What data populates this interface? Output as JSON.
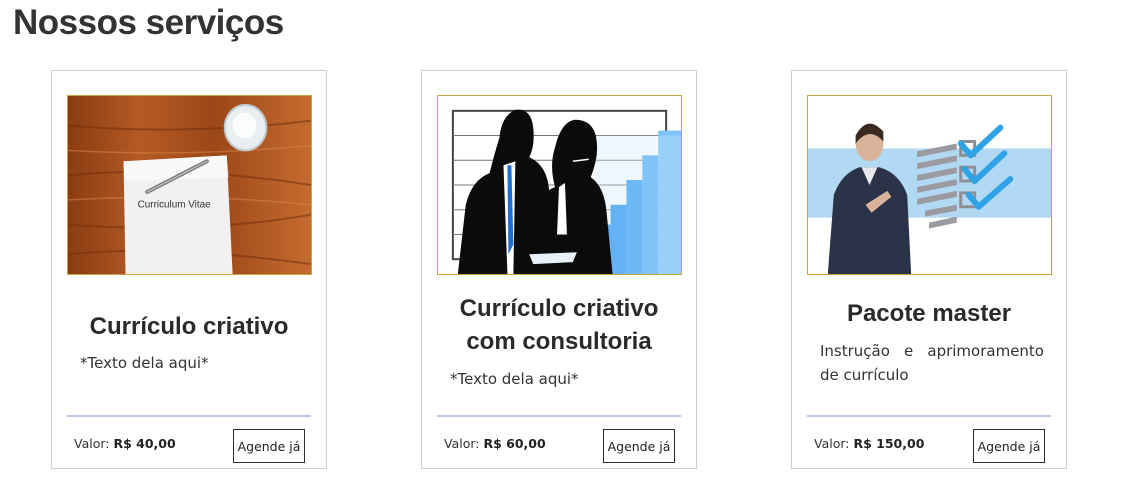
{
  "page": {
    "title": "Nossos serviços"
  },
  "cards": [
    {
      "image_label": "Curriculum Vitae",
      "title": "Currículo criativo",
      "title_line2": "",
      "description": "*Texto dela aqui*",
      "price_label": "Valor:",
      "price_value": "R$ 40,00",
      "button_label": "Agende já"
    },
    {
      "image_label": "",
      "title": "Currículo criativo",
      "title_line2": "com consultoria",
      "description": "*Texto dela aqui*",
      "price_label": "Valor:",
      "price_value": "R$ 60,00",
      "button_label": "Agende já"
    },
    {
      "image_label": "",
      "title": "Pacote master",
      "title_line2": "",
      "description": "Instrução e aprimoramento de currículo",
      "price_label": "Valor:",
      "price_value": "R$ 150,00",
      "button_label": "Agende já"
    }
  ],
  "colors": {
    "divider": "#b9c9df",
    "image_border": "#c8a640",
    "card_border": "#cfcfcf",
    "accent_blue": "#1e88e5"
  }
}
